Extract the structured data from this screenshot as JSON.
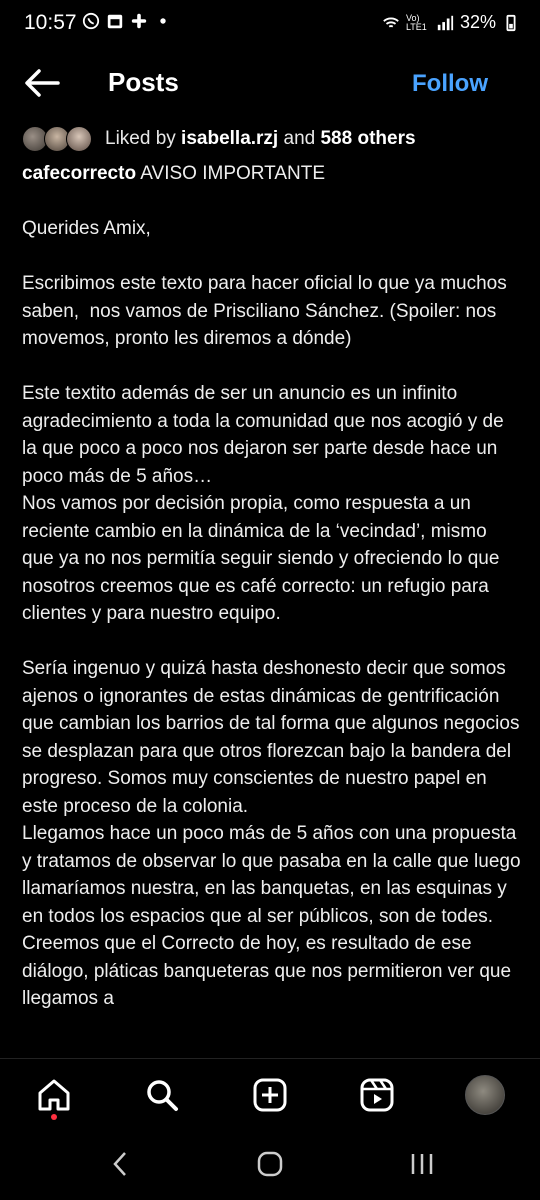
{
  "status_bar": {
    "time": "10:57",
    "battery": "32%",
    "notification_icons": [
      "whatsapp-icon",
      "calendar-icon",
      "slack-icon",
      "dot-icon"
    ],
    "system_icons": [
      "wifi-icon",
      "volte-icon",
      "signal-icon",
      "battery-icon"
    ],
    "volte_label": "Vo) LTE1"
  },
  "header": {
    "title": "Posts",
    "follow_label": "Follow"
  },
  "likes": {
    "prefix": "Liked by ",
    "user": "isabella.rzj",
    "middle": " and ",
    "count": "588 others"
  },
  "caption": {
    "username": "cafecorrecto",
    "headline": " AVISO IMPORTANTE",
    "paragraphs": [
      "Querides Amix,",
      "Escribimos este texto para hacer oficial lo que ya muchos saben,  nos vamos de Prisciliano Sánchez. (Spoiler: nos movemos, pronto les diremos a dónde)",
      "Este textito además de ser un anuncio es un infinito agradecimiento a toda la comunidad que nos acogió y de la que poco a poco nos dejaron ser parte desde hace un poco más de 5 años…\nNos vamos por decisión propia, como respuesta a un reciente cambio en la dinámica de la ‘vecindad’, mismo que ya no nos permitía seguir siendo y ofreciendo lo que nosotros creemos que es café correcto: un refugio para clientes y para nuestro equipo.",
      "Sería ingenuo y quizá hasta deshonesto decir que somos ajenos o ignorantes de estas dinámicas de gentrificación que cambian los barrios de tal forma que algunos negocios se desplazan para que otros florezcan bajo la bandera del progreso. Somos muy conscientes de nuestro papel en este proceso de la colonia.\nLlegamos hace un poco más de 5 años con una propuesta y tratamos de observar lo que pasaba en la calle que luego llamaríamos nuestra, en las banquetas, en las esquinas y en todos los espacios que al ser públicos, son de todes. Creemos que el Correcto de hoy, es resultado de ese diálogo, pláticas banqueteras que nos permitieron ver que llegamos a"
    ]
  },
  "bottom_nav": {
    "items": [
      "home-icon",
      "search-icon",
      "create-icon",
      "reels-icon",
      "profile-avatar"
    ],
    "active": "home-icon"
  },
  "system_nav": [
    "recents-back-icon",
    "home-circle-icon",
    "recent-apps-icon"
  ],
  "colors": {
    "background": "#000000",
    "accent": "#4aa3ff",
    "notification_dot": "#ff3040"
  }
}
